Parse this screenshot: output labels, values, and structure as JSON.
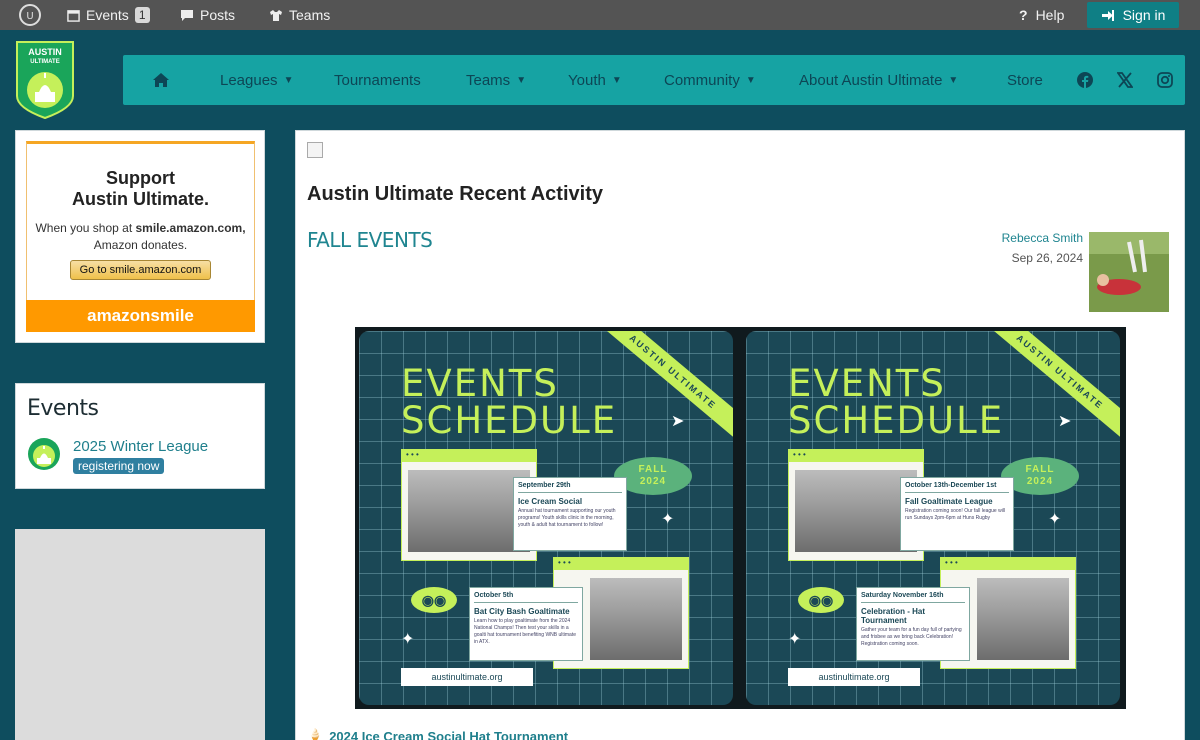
{
  "topbar": {
    "events_label": "Events",
    "events_count": "1",
    "posts_label": "Posts",
    "teams_label": "Teams",
    "help_label": "Help",
    "signin_label": "Sign in"
  },
  "brand": {
    "line1": "AUSTIN",
    "line2": "ULTIMATE"
  },
  "nav": {
    "leagues": "Leagues",
    "tournaments": "Tournaments",
    "teams": "Teams",
    "youth": "Youth",
    "community": "Community",
    "about": "About Austin Ultimate",
    "store": "Store"
  },
  "smile_card": {
    "line1": "Support",
    "line2": "Austin Ultimate.",
    "shop_text_pre": "When you shop at ",
    "shop_domain": "smile.amazon.com,",
    "shop_text_post": "Amazon donates.",
    "button": "Go to smile.amazon.com",
    "footer": "amazonsmile"
  },
  "events_card": {
    "title": "Events",
    "event_name": "2025 Winter League",
    "event_status": "registering now"
  },
  "main": {
    "title": "Austin Ultimate Recent Activity",
    "post_title": "FALL EVENTS",
    "author": "Rebecca Smith",
    "date": "Sep 26, 2024",
    "link": "2024 Ice Cream Social Hat Tournament"
  },
  "flyer": {
    "ribbon": "AUSTIN ULTIMATE",
    "heading1": "EVENTS",
    "heading2": "SCHEDULE",
    "season1": "FALL",
    "season2": "2024",
    "url": "austinultimate.org",
    "left": {
      "e1_date": "September 29th",
      "e1_name": "Ice Cream Social",
      "e1_desc": "Annual hat tournament supporting our youth programs! Youth skills clinic in the morning, youth & adult hat tournament to follow!",
      "e2_date": "October 5th",
      "e2_name": "Bat City Bash Goaltimate",
      "e2_desc": "Learn how to play goaltimate from the 2024 National Champs! Then test your skills in a goalti hat tournament benefiting WNB ultimate in ATX."
    },
    "right": {
      "e1_date": "October 13th-December 1st",
      "e1_name": "Fall Goaltimate League",
      "e1_desc": "Registration coming soon! Our fall league will run Sundays 2pm-6pm at Huns Rugby",
      "e2_date": "Saturday November 16th",
      "e2_name": "Celebration - Hat Tournament",
      "e2_desc": "Gather your team for a fun day full of partying and frisbee as we bring back Celebration! Registration coming soon."
    }
  },
  "colors": {
    "page_bg": "#0e4d5e",
    "nav_bg": "#16a3a3",
    "accent_green": "#c5f05a",
    "link": "#1f8590"
  }
}
